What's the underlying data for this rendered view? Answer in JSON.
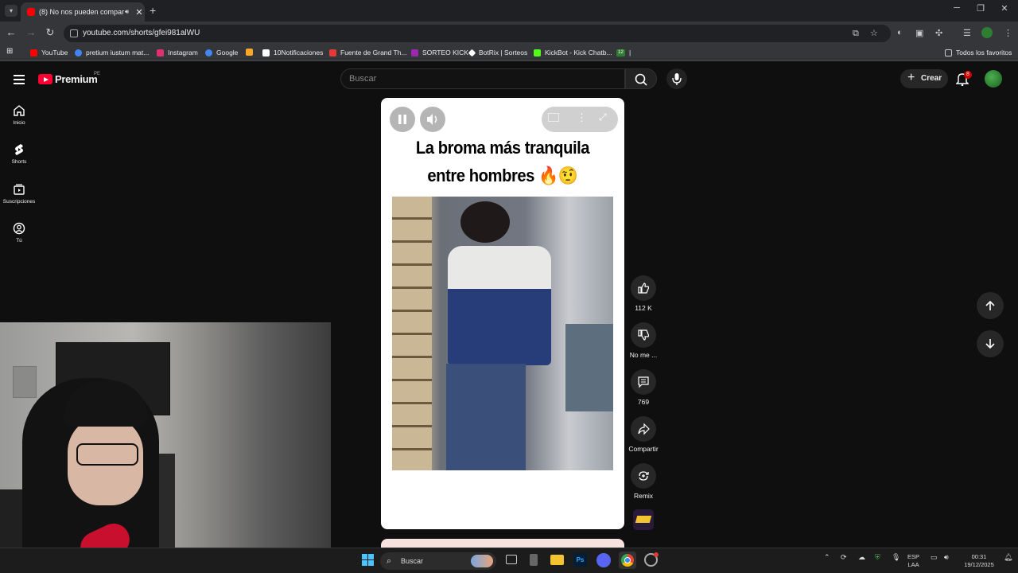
{
  "browser": {
    "tab_title": "(8) No nos pueden compar",
    "url": "youtube.com/shorts/gfei981alWU",
    "bookmarks": [
      "YouTube",
      "pretium iustum mat...",
      "Instagram",
      "Google",
      "10Notificaciones",
      "Fuente de Grand Th...",
      "SORTEO KICK",
      "BotRix | Sorteos",
      "KickBot - Kick Chatb...",
      "12",
      "Todos los favoritos"
    ],
    "bookmark_colors": [
      "#ff0000",
      "#4285f4",
      "#e1306c",
      "#4285f4",
      "#ffffff",
      "#e53935",
      "#9c27b0",
      "#ffffff",
      "#53fc18",
      "#2e7d32"
    ]
  },
  "youtube": {
    "logo_text": "Premium",
    "logo_region": "PE",
    "search_placeholder": "Buscar",
    "create_label": "Crear",
    "notif_count": "8",
    "sidebar": [
      "Inicio",
      "Shorts",
      "Suscripciones",
      "Tú"
    ],
    "short": {
      "title_line1": "La broma más tranquila",
      "title_line2": "entre hombres 🔥🤨"
    },
    "actions": {
      "likes": "112 K",
      "dislike": "No me ...",
      "comments": "769",
      "share": "Compartir",
      "remix": "Remix"
    }
  },
  "taskbar": {
    "search": "Buscar",
    "lang1": "ESP",
    "lang2": "LAA",
    "time": "00:31",
    "date": "19/12/2025"
  }
}
